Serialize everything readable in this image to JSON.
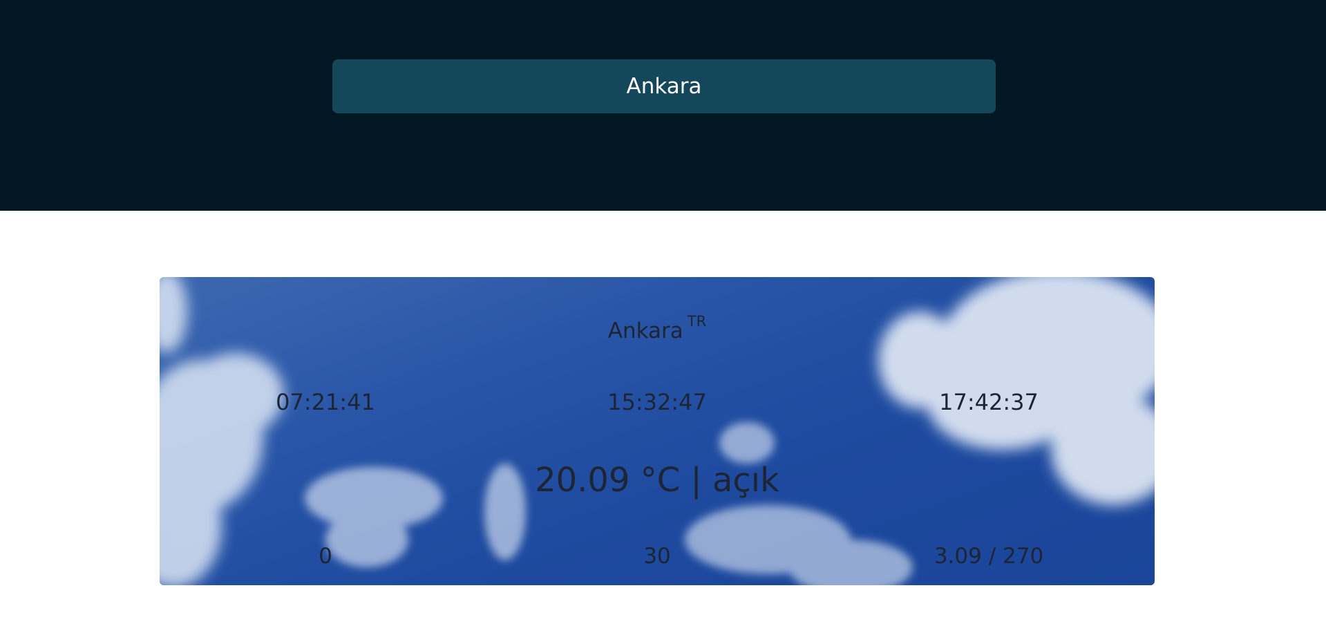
{
  "search": {
    "value": "Ankara"
  },
  "weather": {
    "city": "Ankara",
    "country": "TR",
    "times": [
      "07:21:41",
      "15:32:47",
      "17:42:37"
    ],
    "temperature_line": "20.09 °C | açık",
    "stats": [
      "0",
      "30",
      "3.09 / 270"
    ]
  },
  "colors": {
    "header_bg": "#011722",
    "search_bg": "#15475b",
    "card_sky": "#1e4a9f",
    "text_dark": "#1d2433"
  }
}
